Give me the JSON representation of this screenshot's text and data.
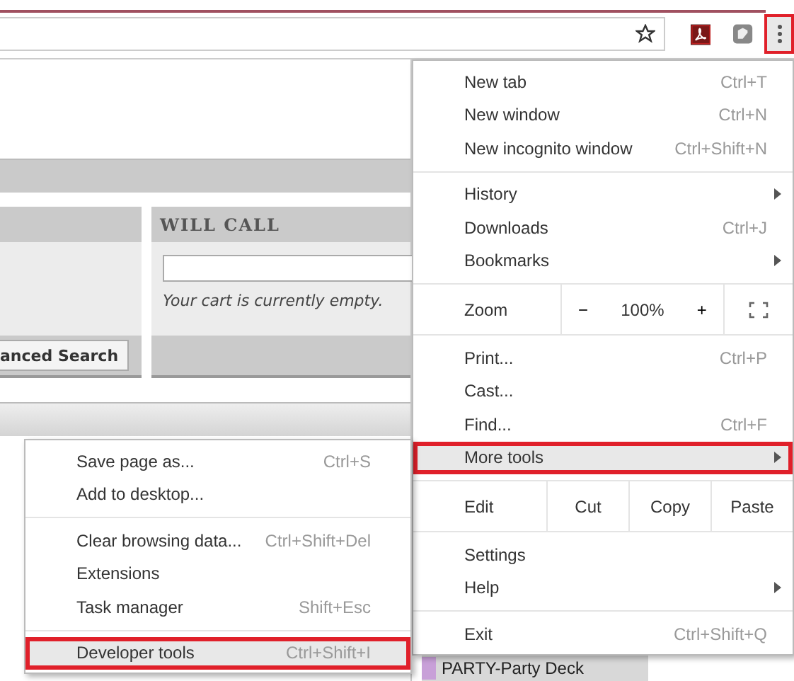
{
  "toolbar": {
    "menu_button": {
      "annotated": true
    }
  },
  "page": {
    "will_call": {
      "title": "WILL CALL",
      "cart_text": "Your cart is currently empty."
    },
    "search_button": "anced Search",
    "covered_row": "PARTY-Party Deck"
  },
  "menu": {
    "groups": [
      [
        {
          "kind": "item",
          "label": "New tab",
          "shortcut": "Ctrl+T",
          "submenu": false,
          "selected": false
        },
        {
          "kind": "item",
          "label": "New window",
          "shortcut": "Ctrl+N",
          "submenu": false,
          "selected": false
        },
        {
          "kind": "item",
          "label": "New incognito window",
          "shortcut": "Ctrl+Shift+N",
          "submenu": false,
          "selected": false
        }
      ],
      [
        {
          "kind": "item",
          "label": "History",
          "submenu": true,
          "selected": false
        },
        {
          "kind": "item",
          "label": "Downloads",
          "shortcut": "Ctrl+J",
          "submenu": false,
          "selected": false
        },
        {
          "kind": "item",
          "label": "Bookmarks",
          "submenu": true,
          "selected": false
        }
      ],
      [
        {
          "kind": "zoom",
          "label": "Zoom",
          "minus": "−",
          "value": "100%",
          "plus": "+"
        }
      ],
      [
        {
          "kind": "item",
          "label": "Print...",
          "shortcut": "Ctrl+P",
          "submenu": false,
          "selected": false
        },
        {
          "kind": "item",
          "label": "Cast...",
          "submenu": false,
          "selected": false
        },
        {
          "kind": "item",
          "label": "Find...",
          "shortcut": "Ctrl+F",
          "submenu": false,
          "selected": false
        },
        {
          "kind": "item",
          "label": "More tools",
          "submenu": true,
          "selected": true
        }
      ],
      [
        {
          "kind": "edit",
          "label": "Edit",
          "buttons": [
            "Cut",
            "Copy",
            "Paste"
          ]
        }
      ],
      [
        {
          "kind": "item",
          "label": "Settings",
          "submenu": false,
          "selected": false
        },
        {
          "kind": "item",
          "label": "Help",
          "submenu": true,
          "selected": false
        }
      ],
      [
        {
          "kind": "item",
          "label": "Exit",
          "shortcut": "Ctrl+Shift+Q",
          "submenu": false,
          "selected": false
        }
      ]
    ]
  },
  "submenu": {
    "groups": [
      [
        {
          "kind": "item",
          "label": "Save page as...",
          "shortcut": "Ctrl+S",
          "submenu": false,
          "selected": false
        },
        {
          "kind": "item",
          "label": "Add to desktop...",
          "submenu": false,
          "selected": false
        }
      ],
      [
        {
          "kind": "item",
          "label": "Clear browsing data...",
          "shortcut": "Ctrl+Shift+Del",
          "submenu": false,
          "selected": false
        },
        {
          "kind": "item",
          "label": "Extensions",
          "submenu": false,
          "selected": false
        },
        {
          "kind": "item",
          "label": "Task manager",
          "shortcut": "Shift+Esc",
          "submenu": false,
          "selected": false
        }
      ],
      [
        {
          "kind": "item",
          "label": "Developer tools",
          "shortcut": "Ctrl+Shift+I",
          "submenu": false,
          "selected": true
        }
      ]
    ]
  }
}
